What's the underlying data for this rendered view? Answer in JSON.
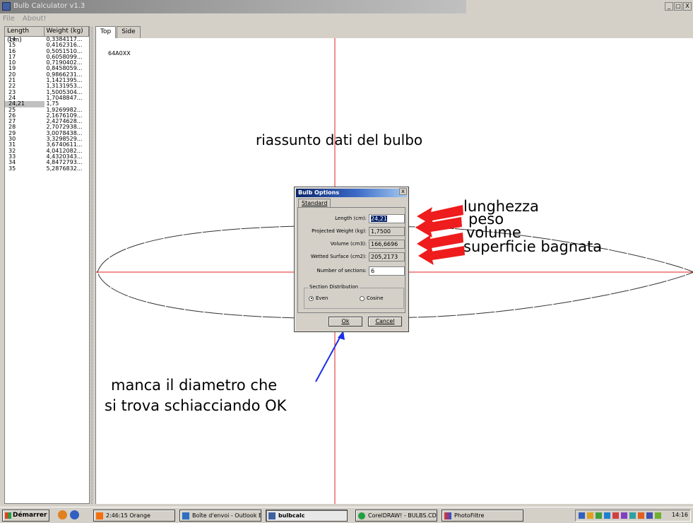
{
  "window": {
    "title": "Bulb Calculator v1.3",
    "menu": [
      "File",
      "About!"
    ],
    "controls": [
      "_",
      "□",
      "X"
    ]
  },
  "list": {
    "headers": [
      "Length (cm)",
      "Weight (kg)"
    ],
    "rows": [
      [
        "14",
        "0,3384117..."
      ],
      [
        "15",
        "0,4162316..."
      ],
      [
        "16",
        "0,5051510..."
      ],
      [
        "17",
        "0,6058099..."
      ],
      [
        "10",
        "0,7190402..."
      ],
      [
        "19",
        "0,8458059..."
      ],
      [
        "20",
        "0,9866231..."
      ],
      [
        "21",
        "1,1421395..."
      ],
      [
        "22",
        "1,3131953..."
      ],
      [
        "23",
        "1,5005304..."
      ],
      [
        "24",
        "1,7048847..."
      ],
      [
        "24,21",
        "1,75"
      ],
      [
        "25",
        "1,9269982..."
      ],
      [
        "26",
        "2,1676109..."
      ],
      [
        "27",
        "2,4274628..."
      ],
      [
        "28",
        "2,7072938..."
      ],
      [
        "29",
        "3,0078438..."
      ],
      [
        "30",
        "3,3298529..."
      ],
      [
        "31",
        "3,6740611..."
      ],
      [
        "32",
        "4,0412082..."
      ],
      [
        "33",
        "4,4320343..."
      ],
      [
        "34",
        "4,8472793..."
      ],
      [
        "35",
        "5,2876832..."
      ]
    ],
    "selected_index": 11
  },
  "view_tabs": [
    "Top",
    "Side"
  ],
  "canvas": {
    "code_label": "64A0XX",
    "accent_color": "#e02020"
  },
  "dialog": {
    "title": "Bulb Options",
    "close": "x",
    "tab": "Standard",
    "fields": [
      {
        "label": "Length (cm):",
        "value": "24,21"
      },
      {
        "label": "Projected Weight (kg):",
        "value": "1,7500"
      },
      {
        "label": "Volume (cm3):",
        "value": "166,6696"
      },
      {
        "label": "Wetted Surface (cm2):",
        "value": "205,2173"
      },
      {
        "label": "Number of sections:",
        "value": "6"
      }
    ],
    "group_label": "Section Distribution",
    "radio_even": "Even",
    "radio_cosine": "Cosine",
    "selected_distribution": "Even",
    "ok": "Ok",
    "cancel": "Cancel"
  },
  "annotations": {
    "heading": "riassunto dati del bulbo",
    "labels": [
      "lunghezza",
      "peso",
      "volume",
      "superficie bagnata"
    ],
    "note_line1": "manca il diametro che",
    "note_line2": "si trova schiacciando OK",
    "arrow_color": "#ee1c1c",
    "pointer_color": "#1c2ee8"
  },
  "taskbar": {
    "start": "Démarrer",
    "items": [
      "2:46:15 Orange",
      "Boîte d'envoi - Outlook E...",
      "bulbcalc",
      "CorelDRAW! - BULBS.CDR",
      "PhotoFiltre"
    ],
    "active_index": 2,
    "clock": "14:16"
  }
}
